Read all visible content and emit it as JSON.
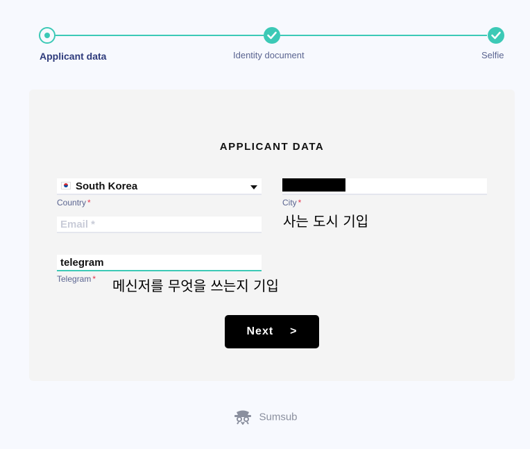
{
  "stepper": {
    "steps": [
      {
        "label": "Applicant data",
        "state": "current"
      },
      {
        "label": "Identity document",
        "state": "done"
      },
      {
        "label": "Selfie",
        "state": "done"
      }
    ],
    "accent_color": "#3cc9b6"
  },
  "form": {
    "title": "APPLICANT DATA",
    "country": {
      "value": "South Korea",
      "label": "Country",
      "required": "*"
    },
    "city": {
      "value": "",
      "label": "City",
      "required": "*",
      "note": "사는 도시 기입"
    },
    "email": {
      "value": "",
      "placeholder": "Email *"
    },
    "telegram": {
      "value": "telegram",
      "label": "Telegram",
      "required": "*",
      "note": "메신저를 무엇을 쓰는지 기입"
    },
    "next_label": "Next",
    "next_arrow": ">"
  },
  "footer": {
    "brand": "Sumsub"
  }
}
